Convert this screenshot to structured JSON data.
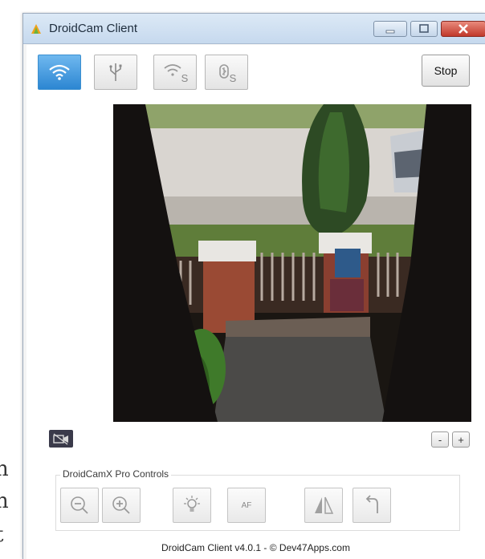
{
  "window": {
    "title": "DroidCam Client",
    "app_icon": "droidcam-logo-icon",
    "caption_buttons": [
      "minimize-icon",
      "maximize-icon",
      "close-icon"
    ]
  },
  "toolbar": {
    "connection_buttons": [
      {
        "icon": "wifi-icon",
        "active": true
      },
      {
        "icon": "usb-icon",
        "active": false
      },
      {
        "icon": "wifi-server-icon",
        "subscript": "S",
        "active": false
      },
      {
        "icon": "bluetooth-server-icon",
        "subscript": "S",
        "active": false
      }
    ],
    "stop_label": "Stop"
  },
  "video": {
    "description_icon": "camera-video-feed"
  },
  "controls": {
    "camera_toggle_icon": "camera-off-icon",
    "zoom_out_label": "-",
    "zoom_in_label": "+"
  },
  "pro_controls": {
    "title": "DroidCamX Pro Controls",
    "buttons": [
      {
        "icon": "zoom-out-icon"
      },
      {
        "icon": "zoom-in-icon"
      },
      {
        "icon": "flash-light-icon"
      },
      {
        "icon": "autofocus-icon",
        "label": "AF"
      },
      {
        "icon": "mirror-flip-icon"
      },
      {
        "icon": "rotate-icon"
      }
    ]
  },
  "footer": {
    "text": "DroidCam Client v4.0.1 - © Dev47Apps.com"
  },
  "colors": {
    "accent": "#2c86d2",
    "titlebar": "#c6d9ee",
    "close_button": "#c1392b"
  }
}
